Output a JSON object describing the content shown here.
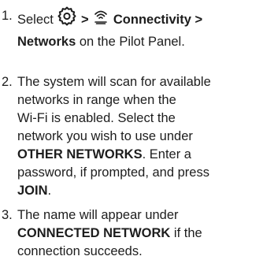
{
  "steps": [
    {
      "number": "1.",
      "select_word": "Select",
      "gear_icon": "gear-icon",
      "separator_1": ">",
      "wifi_icon": "wifi-icon",
      "menu_connectivity": "Connectivity",
      "separator_2": ">",
      "menu_networks": "Networks",
      "tail": "on the Pilot Panel."
    },
    {
      "number": "2.",
      "line1": "The system will scan for available",
      "line2": "networks in range when the",
      "line3": "Wi-Fi is enabled. Select the",
      "line4": "network you wish to use under",
      "other_networks": "OTHER NETWORKS",
      "line5_tail": ". Enter a",
      "line6": "password, if prompted, and press",
      "join": "JOIN",
      "line7_tail": "."
    },
    {
      "number": "3.",
      "line1_head": "The name will appear under",
      "connected_network": "CONNECTED NETWORK",
      "line2_tail": " if the",
      "line3": "connection succeeds."
    }
  ]
}
